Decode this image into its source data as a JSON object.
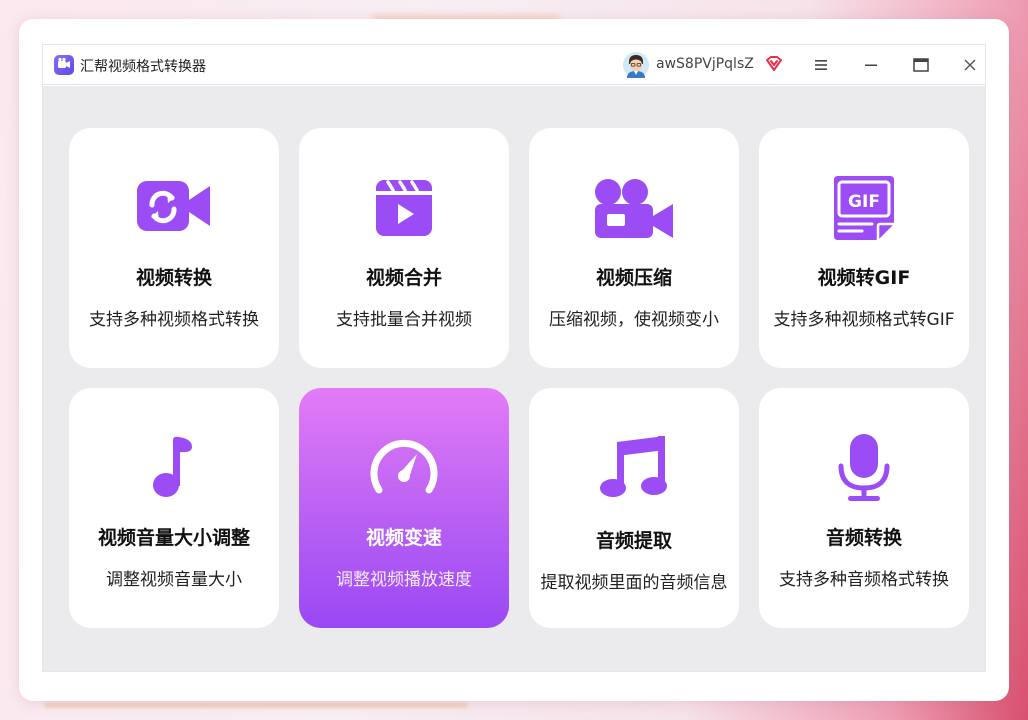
{
  "window": {
    "title": "汇帮视频格式转换器",
    "username": "awS8PVjPqlsZ"
  },
  "colors": {
    "accent": "#9b4cf5",
    "active_gradient_top": "#e37bf7",
    "active_gradient_bottom": "#9a48f5",
    "vip_red": "#e8304a"
  },
  "tools": [
    {
      "title": "视频转换",
      "desc": "支持多种视频格式转换",
      "icon": "video-convert-icon",
      "active": false
    },
    {
      "title": "视频合并",
      "desc": "支持批量合并视频",
      "icon": "clapperboard-icon",
      "active": false
    },
    {
      "title": "视频压缩",
      "desc": "压缩视频，使视频变小",
      "icon": "video-camera-icon",
      "active": false
    },
    {
      "title": "视频转GIF",
      "desc": "支持多种视频格式转GIF",
      "icon": "gif-file-icon",
      "active": false
    },
    {
      "title": "视频音量大小调整",
      "desc": "调整视频音量大小",
      "icon": "music-note-icon",
      "active": false
    },
    {
      "title": "视频变速",
      "desc": "调整视频播放速度",
      "icon": "speedometer-icon",
      "active": true
    },
    {
      "title": "音频提取",
      "desc": "提取视频里面的音频信息",
      "icon": "music-notes-icon",
      "active": false
    },
    {
      "title": "音频转换",
      "desc": "支持多种音频格式转换",
      "icon": "microphone-icon",
      "active": false
    }
  ]
}
